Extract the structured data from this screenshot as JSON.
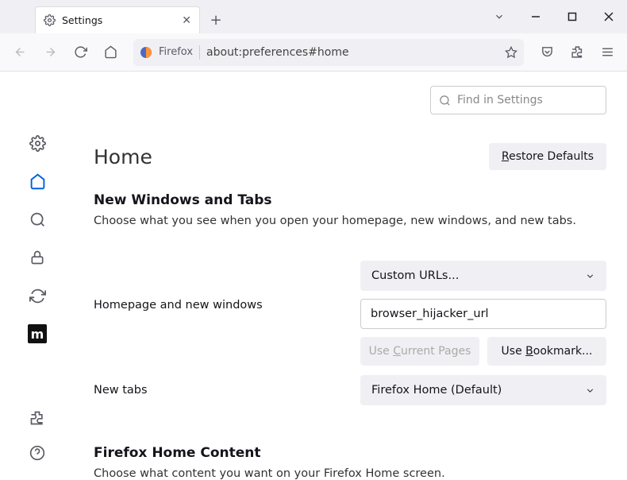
{
  "tab": {
    "title": "Settings"
  },
  "urlbar": {
    "label": "Firefox",
    "address": "about:preferences#home"
  },
  "search": {
    "placeholder": "Find in Settings"
  },
  "page": {
    "title": "Home",
    "restore": "Restore Defaults",
    "section1_title": "New Windows and Tabs",
    "section1_desc": "Choose what you see when you open your homepage, new windows, and new tabs.",
    "homepage_label": "Homepage and new windows",
    "homepage_select": "Custom URLs...",
    "homepage_value": "browser_hijacker_url",
    "use_current": "Use Current Pages",
    "use_bookmark": "Use Bookmark...",
    "newtabs_label": "New tabs",
    "newtabs_select": "Firefox Home (Default)",
    "section2_title": "Firefox Home Content",
    "section2_desc": "Choose what content you want on your Firefox Home screen."
  }
}
